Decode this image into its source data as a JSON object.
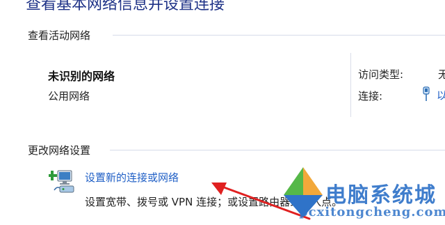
{
  "page_heading": "查看基本网络信息并设置连接",
  "active_networks": {
    "section_title": "查看活动网络",
    "network_name": "未识别的网络",
    "network_type": "公用网络",
    "access_type_label": "访问类型:",
    "access_type_value": "无",
    "connection_label": "连接:",
    "connection_value": "以"
  },
  "change_settings": {
    "section_title": "更改网络设置",
    "setup_link": "设置新的连接或网络",
    "setup_desc": "设置宽带、拨号或 VPN 连接；或设置路由器或接入点。"
  },
  "watermark": {
    "title": "电脑系统城",
    "url": "pcxitongcheng.com"
  },
  "colors": {
    "link": "#1f5fc6",
    "heading": "#1e3287",
    "arrow": "#e02020",
    "watermark": "#2f73c8"
  }
}
